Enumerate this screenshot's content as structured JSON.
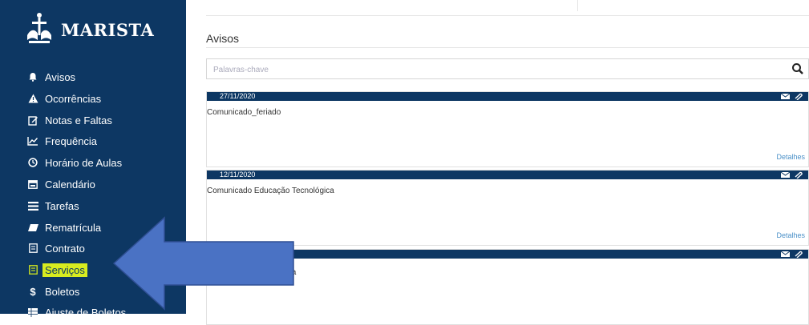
{
  "brand": {
    "name": "MARISTA"
  },
  "sidebar": {
    "items": [
      {
        "label": "Avisos",
        "icon": "bell-icon"
      },
      {
        "label": "Ocorrências",
        "icon": "warning-icon"
      },
      {
        "label": "Notas e Faltas",
        "icon": "edit-icon"
      },
      {
        "label": "Frequência",
        "icon": "line-chart-icon"
      },
      {
        "label": "Horário de Aulas",
        "icon": "clock-icon"
      },
      {
        "label": "Calendário",
        "icon": "calendar-icon"
      },
      {
        "label": "Tarefas",
        "icon": "list-icon"
      },
      {
        "label": "Rematrícula",
        "icon": "eraser-icon"
      },
      {
        "label": "Contrato",
        "icon": "document-icon"
      },
      {
        "label": "Serviços",
        "icon": "document-icon",
        "active": true
      },
      {
        "label": "Boletos",
        "icon": "dollar-icon"
      },
      {
        "label": "Ajuste de Boletos",
        "icon": "grid-icon"
      }
    ]
  },
  "main": {
    "title": "Avisos",
    "search": {
      "placeholder": "Palavras-chave",
      "icon": "search-icon"
    },
    "notices": [
      {
        "date": "27/11/2020",
        "subject": "Comunicado_feriado",
        "details_label": "Detalhes"
      },
      {
        "date": "12/11/2020",
        "subject": "Comunicado Educação Tecnológica",
        "details_label": "Detalhes"
      },
      {
        "date": "",
        "subject": "cula",
        "details_label": ""
      }
    ]
  },
  "colors": {
    "sidebar_bg": "#0d3763",
    "highlight": "#d8ec1f",
    "arrow_fill": "#4a72c4",
    "link": "#4a90c8"
  }
}
